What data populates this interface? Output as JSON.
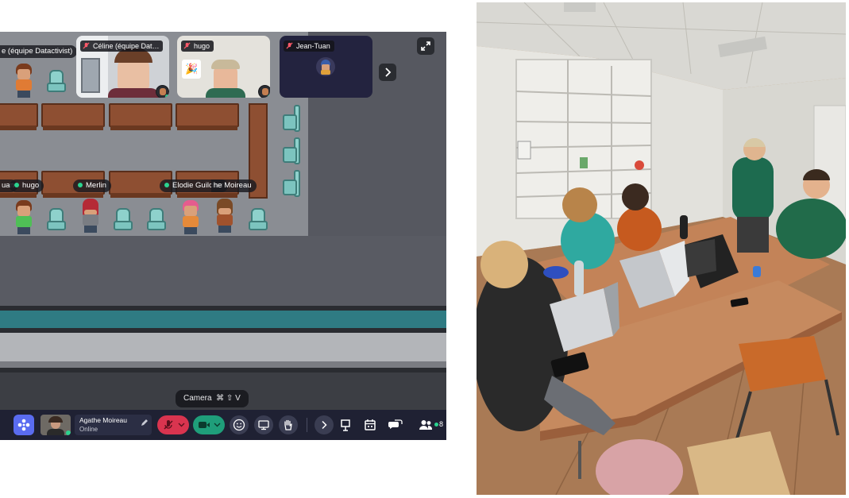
{
  "gather": {
    "tiles": [
      {
        "name": "Céline (équipe Dat…",
        "mic_muted": true
      },
      {
        "name": "hugo",
        "mic_muted": true
      },
      {
        "name": "Jean-Tuan",
        "mic_muted": true
      }
    ],
    "map_labels": {
      "top_left": "e (équipe Datactivist)",
      "jean": "uan",
      "hugo": "hugo",
      "merlin": "Merlin",
      "elodie": "Elodie Guilcher",
      "agathe": "he Moireau"
    },
    "tooltip": {
      "label": "Camera",
      "shortcut": "⌘ ⇧ V"
    },
    "profile": {
      "name": "Agathe Moireau",
      "status": "Online"
    },
    "participant_count": "8",
    "colors": {
      "accent": "#5a6cf0",
      "mic_off": "#d9344f",
      "camera_on": "#1f9e7a",
      "toolbar_bg": "#1f2133",
      "online": "#2bd38f"
    }
  },
  "photo": {
    "alt": "Photo of a team meeting around a table with laptops"
  }
}
